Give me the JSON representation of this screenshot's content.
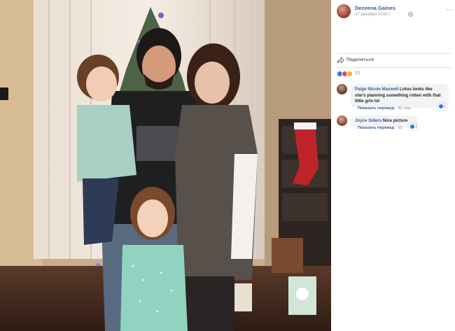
{
  "post": {
    "author_name": "Deceena Gaines",
    "date": "27 декабря 2016 г.",
    "more_icon": "more-icon",
    "privacy_icon": "globe-icon"
  },
  "actions": {
    "share_label": "Поделиться",
    "share_icon": "share-icon"
  },
  "reactions": {
    "count": "77",
    "types": [
      "like",
      "love",
      "haha"
    ],
    "colors": {
      "like": "#2078f4",
      "love": "#f33e58",
      "haha": "#f7b125"
    }
  },
  "comments": [
    {
      "author": "Paige Nicole Maxwell",
      "text": "Lotus looks like she's planning something rotten with that little grin lol",
      "translate_label": "Показать перевод",
      "time": "81 нед.",
      "likes": "1"
    },
    {
      "author": "Joyce Siders",
      "text": "Nice picture",
      "translate_label": "Показать перевод",
      "time": "81",
      "likes": "1"
    }
  ],
  "colors": {
    "link": "#365899",
    "meta": "#90949c",
    "bubble": "#f2f3f5"
  }
}
